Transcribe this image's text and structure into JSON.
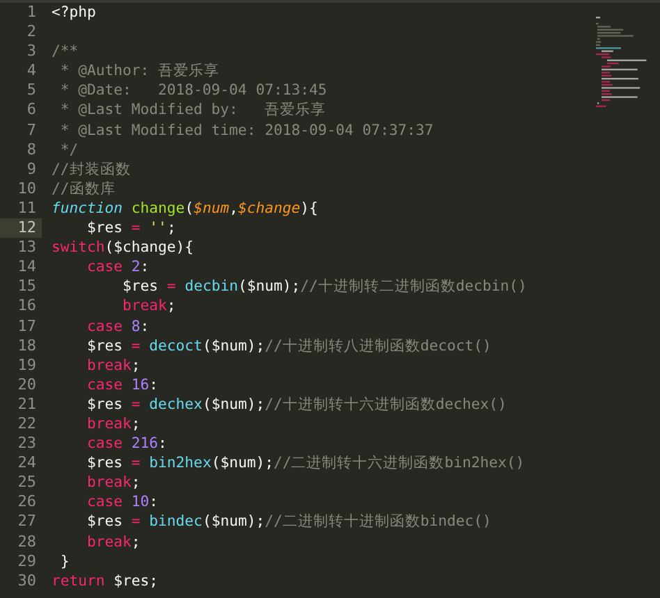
{
  "editor": {
    "lines": [
      {
        "number": "1",
        "current": false,
        "tokens": [
          {
            "kind": "plain",
            "text": "<?php"
          }
        ]
      },
      {
        "number": "2",
        "current": false
      },
      {
        "number": "3",
        "current": false,
        "tokens": [
          {
            "kind": "comment",
            "text": "/**"
          }
        ]
      },
      {
        "number": "4",
        "current": false,
        "tokens": [
          {
            "kind": "comment",
            "text": " * @Author: 吾爱乐享"
          }
        ]
      },
      {
        "number": "5",
        "current": false,
        "tokens": [
          {
            "kind": "comment",
            "text": " * @Date:   2018-09-04 07:13:45"
          }
        ]
      },
      {
        "number": "6",
        "current": false,
        "tokens": [
          {
            "kind": "comment",
            "text": " * @Last Modified by:   吾爱乐享"
          }
        ]
      },
      {
        "number": "7",
        "current": false,
        "tokens": [
          {
            "kind": "comment",
            "text": " * @Last Modified time: 2018-09-04 07:37:37"
          }
        ]
      },
      {
        "number": "8",
        "current": false,
        "tokens": [
          {
            "kind": "comment",
            "text": " */"
          }
        ]
      },
      {
        "number": "9",
        "current": false,
        "tokens": [
          {
            "kind": "comment",
            "text": "//封装函数"
          }
        ]
      },
      {
        "number": "10",
        "current": false,
        "tokens": [
          {
            "kind": "comment",
            "text": "//函数库"
          }
        ]
      },
      {
        "number": "11",
        "current": false,
        "tokens": [
          {
            "kind": "storage",
            "text": "function "
          },
          {
            "kind": "func",
            "text": "change"
          },
          {
            "kind": "plain",
            "text": "("
          },
          {
            "kind": "param",
            "text": "$num"
          },
          {
            "kind": "plain",
            "text": ","
          },
          {
            "kind": "param",
            "text": "$change"
          },
          {
            "kind": "plain",
            "text": "){"
          }
        ]
      },
      {
        "number": "12",
        "current": true,
        "tokens": [
          {
            "kind": "plain",
            "text": "    $res "
          },
          {
            "kind": "op",
            "text": "= "
          },
          {
            "kind": "string",
            "text": "''"
          },
          {
            "kind": "plain",
            "text": ";"
          }
        ]
      },
      {
        "number": "13",
        "current": false,
        "tokens": [
          {
            "kind": "keyword",
            "text": "switch"
          },
          {
            "kind": "plain",
            "text": "($change){"
          }
        ]
      },
      {
        "number": "14",
        "current": false,
        "tokens": [
          {
            "kind": "keyword",
            "text": "    case "
          },
          {
            "kind": "number",
            "text": "2"
          },
          {
            "kind": "plain",
            "text": ":"
          }
        ]
      },
      {
        "number": "15",
        "current": false,
        "tokens": [
          {
            "kind": "plain",
            "text": "        $res "
          },
          {
            "kind": "op",
            "text": "= "
          },
          {
            "kind": "builtin",
            "text": "decbin"
          },
          {
            "kind": "plain",
            "text": "($num);"
          },
          {
            "kind": "comment",
            "text": "//十进制转二进制函数decbin()"
          }
        ]
      },
      {
        "number": "16",
        "current": false,
        "tokens": [
          {
            "kind": "keyword",
            "text": "        break"
          },
          {
            "kind": "plain",
            "text": ";"
          }
        ]
      },
      {
        "number": "17",
        "current": false,
        "tokens": [
          {
            "kind": "keyword",
            "text": "    case "
          },
          {
            "kind": "number",
            "text": "8"
          },
          {
            "kind": "plain",
            "text": ":"
          }
        ]
      },
      {
        "number": "18",
        "current": false,
        "tokens": [
          {
            "kind": "plain",
            "text": "    $res "
          },
          {
            "kind": "op",
            "text": "= "
          },
          {
            "kind": "builtin",
            "text": "decoct"
          },
          {
            "kind": "plain",
            "text": "($num);"
          },
          {
            "kind": "comment",
            "text": "//十进制转八进制函数decoct()"
          }
        ]
      },
      {
        "number": "19",
        "current": false,
        "tokens": [
          {
            "kind": "keyword",
            "text": "    break"
          },
          {
            "kind": "plain",
            "text": ";"
          }
        ]
      },
      {
        "number": "20",
        "current": false,
        "tokens": [
          {
            "kind": "keyword",
            "text": "    case "
          },
          {
            "kind": "number",
            "text": "16"
          },
          {
            "kind": "plain",
            "text": ":"
          }
        ]
      },
      {
        "number": "21",
        "current": false,
        "tokens": [
          {
            "kind": "plain",
            "text": "    $res "
          },
          {
            "kind": "op",
            "text": "= "
          },
          {
            "kind": "builtin",
            "text": "dechex"
          },
          {
            "kind": "plain",
            "text": "($num);"
          },
          {
            "kind": "comment",
            "text": "//十进制转十六进制函数dechex()"
          }
        ]
      },
      {
        "number": "22",
        "current": false,
        "tokens": [
          {
            "kind": "keyword",
            "text": "    break"
          },
          {
            "kind": "plain",
            "text": ";"
          }
        ]
      },
      {
        "number": "23",
        "current": false,
        "tokens": [
          {
            "kind": "keyword",
            "text": "    case "
          },
          {
            "kind": "number",
            "text": "216"
          },
          {
            "kind": "plain",
            "text": ":"
          }
        ]
      },
      {
        "number": "24",
        "current": false,
        "tokens": [
          {
            "kind": "plain",
            "text": "    $res "
          },
          {
            "kind": "op",
            "text": "= "
          },
          {
            "kind": "builtin",
            "text": "bin2hex"
          },
          {
            "kind": "plain",
            "text": "($num);"
          },
          {
            "kind": "comment",
            "text": "//二进制转十六进制函数bin2hex()"
          }
        ]
      },
      {
        "number": "25",
        "current": false,
        "tokens": [
          {
            "kind": "keyword",
            "text": "    break"
          },
          {
            "kind": "plain",
            "text": ";"
          }
        ]
      },
      {
        "number": "26",
        "current": false,
        "tokens": [
          {
            "kind": "keyword",
            "text": "    case "
          },
          {
            "kind": "number",
            "text": "10"
          },
          {
            "kind": "plain",
            "text": ":"
          }
        ]
      },
      {
        "number": "27",
        "current": false,
        "tokens": [
          {
            "kind": "plain",
            "text": "    $res "
          },
          {
            "kind": "op",
            "text": "= "
          },
          {
            "kind": "builtin",
            "text": "bindec"
          },
          {
            "kind": "plain",
            "text": "($num);"
          },
          {
            "kind": "comment",
            "text": "//二进制转十进制函数bindec()"
          }
        ]
      },
      {
        "number": "28",
        "current": false,
        "tokens": [
          {
            "kind": "keyword",
            "text": "    break"
          },
          {
            "kind": "plain",
            "text": ";"
          }
        ]
      },
      {
        "number": "29",
        "current": false,
        "tokens": [
          {
            "kind": "plain",
            "text": " }"
          }
        ]
      },
      {
        "number": "30",
        "current": false,
        "tokens": [
          {
            "kind": "keyword",
            "text": "return"
          },
          {
            "kind": "plain",
            "text": " $res;"
          }
        ]
      }
    ]
  }
}
